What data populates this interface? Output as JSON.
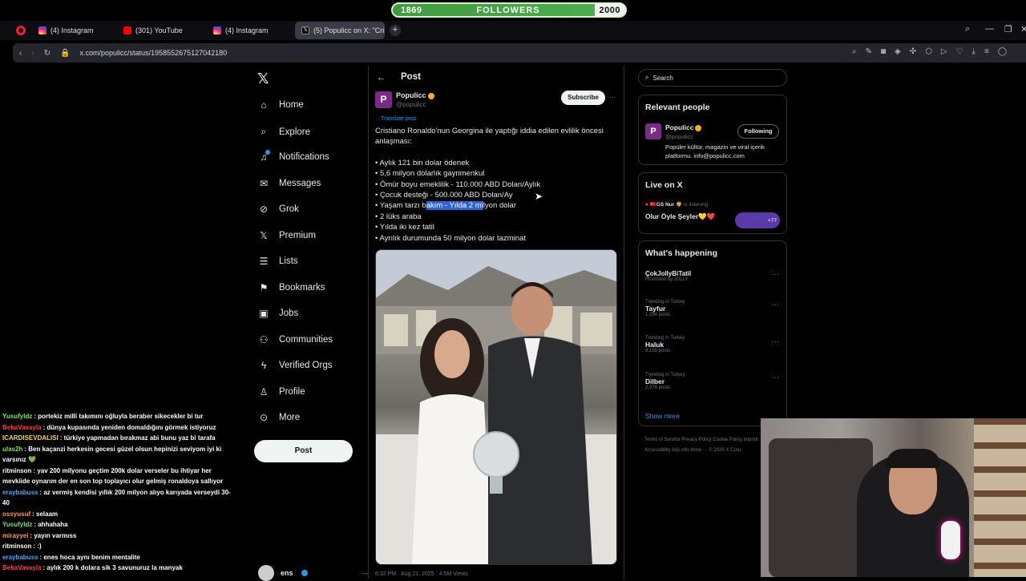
{
  "followers": {
    "current": "1869",
    "label": "FOLLOWERS",
    "goal": "2000",
    "progress": 0.0
  },
  "browser": {
    "tabs": [
      {
        "title": "(4) Instagram",
        "icon": "instagram-icon"
      },
      {
        "title": "(301) YouTube",
        "icon": "youtube-icon"
      },
      {
        "title": "(4) Instagram",
        "icon": "instagram-icon"
      },
      {
        "title": "(5) Populicc on X: \"Cristian",
        "icon": "x-icon",
        "active": true
      }
    ],
    "url": "x.com/populicc/status/1958552675127042180"
  },
  "nav": {
    "items": [
      {
        "label": "Home",
        "icon": "home-icon"
      },
      {
        "label": "Explore",
        "icon": "search-icon"
      },
      {
        "label": "Notifications",
        "icon": "bell-icon"
      },
      {
        "label": "Messages",
        "icon": "mail-icon"
      },
      {
        "label": "Grok",
        "icon": "grok-icon"
      },
      {
        "label": "Premium",
        "icon": "x-icon"
      },
      {
        "label": "Lists",
        "icon": "list-icon"
      },
      {
        "label": "Bookmarks",
        "icon": "bookmark-icon"
      },
      {
        "label": "Jobs",
        "icon": "briefcase-icon"
      },
      {
        "label": "Communities",
        "icon": "people-icon"
      },
      {
        "label": "Verified Orgs",
        "icon": "lightning-icon"
      },
      {
        "label": "Profile",
        "icon": "person-icon"
      },
      {
        "label": "More",
        "icon": "more-circle-icon"
      }
    ],
    "post_button": "Post",
    "account_name": "ens"
  },
  "post": {
    "header": "Post",
    "author": {
      "name": "Populicc",
      "handle": "@populicc"
    },
    "subscribe": "Subscribe",
    "translate": "Translate post",
    "intro": "Cristiano Ronaldo'nun Georgina ile yaptığı iddia edilen evlilik öncesi anlaşması:",
    "bullets": [
      "• Aylık 121 bin dolar ödenek",
      "• 5,6 milyon dolarlık gayrimenkul",
      "• Ömür boyu emeklilik - 110.000 ABD Dolan/Aylık",
      "• Çocuk desteği - 500.000 ABD Dolan/Ay",
      "• Yaşam tarzı bakım - Yılda 2 milyon dolar",
      "• 2 lüks araba",
      "• Yılda iki kez tatil",
      "• Ayrılık durumunda 50 milyon dolar tazminat"
    ],
    "meta": "6:32 PM · Aug 21, 2025 · 4.5M Views"
  },
  "right": {
    "search_placeholder": "Search",
    "relevant_title": "Relevant people",
    "relevant": {
      "name": "Populicc",
      "handle": "@populicc",
      "bio": "Popüler kültür, magazin ve viral içerik platformu. info@populicc.com",
      "button": "Following"
    },
    "live_title": "Live on X",
    "live": {
      "host": "🇹🇷GS Nur 🦁",
      "status": "is listening",
      "title": "Olur Öyle Şeyler💛❤️",
      "count": "+77"
    },
    "happening_title": "What's happening",
    "trends": [
      {
        "meta": "Promoted by JOLLY",
        "name": "ÇokJollyBiTatil",
        "posts": ""
      },
      {
        "meta": "Trending in Turkey",
        "name": "Tayfur",
        "posts": "1,254 posts"
      },
      {
        "meta": "Trending in Turkey",
        "name": "Haluk",
        "posts": "9,155 posts"
      },
      {
        "meta": "Trending in Turkey",
        "name": "Dilber",
        "posts": "2,976 posts"
      }
    ],
    "show_more": "Show more",
    "footer": "Terms of Service  Privacy Policy  Cookie Policy  Imprint  Accessibility  Ads info  More ···  © 2025 X Corp."
  },
  "chat": [
    {
      "user": "Yusufyldz",
      "color": "u-green",
      "msg": ": portekiz milli takımını oğluyla beraber sikecekler bi tur"
    },
    {
      "user": "BekaVavayla",
      "color": "u-red",
      "msg": ": dünya kupasında yeniden domaldığını görmek istiyoruz"
    },
    {
      "user": "ICARDISEVDALISI",
      "color": "u-yellow",
      "msg": ": türkiye yapmadan bırakmaz abi bunu yaz bi tarafa"
    },
    {
      "user": "ulas2h",
      "color": "u-green",
      "msg": ": Ben kaçanzi herkesin gecesi güzel olsun hepinizi seviyom iyi ki varsınız 💚"
    },
    {
      "user": "ritminson",
      "color": "u-white",
      "msg": ": yav 200 milyonu geçtim 200k dolar verseler bu ihtiyar her mevkiide oynarım der en son top toplayıcı olur gelmiş ronaldoya sallıyor"
    },
    {
      "user": "eraybabuss",
      "color": "u-blue",
      "msg": ": az vermiş kendisi yıllık 200 milyon alıyo karıyada verseydi 30-40"
    },
    {
      "user": "ossyusuf",
      "color": "u-orange",
      "msg": ": selaam"
    },
    {
      "user": "Yusufyldz",
      "color": "u-green",
      "msg": ": ahhahaha"
    },
    {
      "user": "mirayyei",
      "color": "u-orange",
      "msg": ": yayın varmıss"
    },
    {
      "user": "ritminson",
      "color": "u-white",
      "msg": ": :)"
    },
    {
      "user": "eraybabuss",
      "color": "u-blue",
      "msg": ": enes hoca aynı benim mentalite"
    },
    {
      "user": "BekaVavayla",
      "color": "u-red",
      "msg": ": aylık 200 k dolara sik 3 savunuruz la manyak"
    }
  ]
}
